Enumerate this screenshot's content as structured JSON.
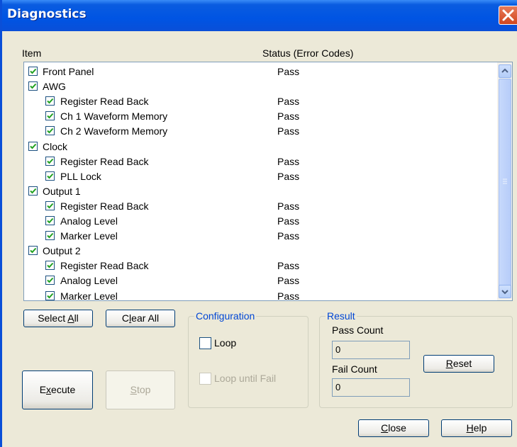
{
  "window": {
    "title": "Diagnostics"
  },
  "headers": {
    "item": "Item",
    "status": "Status (Error Codes)"
  },
  "items": [
    {
      "label": "Front Panel",
      "status": "Pass",
      "level": 0,
      "checked": true
    },
    {
      "label": "AWG",
      "status": "",
      "level": 0,
      "checked": true
    },
    {
      "label": "Register Read Back",
      "status": "Pass",
      "level": 1,
      "checked": true
    },
    {
      "label": "Ch 1 Waveform Memory",
      "status": "Pass",
      "level": 1,
      "checked": true
    },
    {
      "label": "Ch 2 Waveform Memory",
      "status": "Pass",
      "level": 1,
      "checked": true
    },
    {
      "label": "Clock",
      "status": "",
      "level": 0,
      "checked": true
    },
    {
      "label": "Register Read Back",
      "status": "Pass",
      "level": 1,
      "checked": true
    },
    {
      "label": "PLL Lock",
      "status": "Pass",
      "level": 1,
      "checked": true
    },
    {
      "label": "Output 1",
      "status": "",
      "level": 0,
      "checked": true
    },
    {
      "label": "Register Read Back",
      "status": "Pass",
      "level": 1,
      "checked": true
    },
    {
      "label": "Analog Level",
      "status": "Pass",
      "level": 1,
      "checked": true
    },
    {
      "label": "Marker Level",
      "status": "Pass",
      "level": 1,
      "checked": true
    },
    {
      "label": "Output 2",
      "status": "",
      "level": 0,
      "checked": true
    },
    {
      "label": "Register Read Back",
      "status": "Pass",
      "level": 1,
      "checked": true
    },
    {
      "label": "Analog Level",
      "status": "Pass",
      "level": 1,
      "checked": true
    },
    {
      "label": "Marker Level",
      "status": "Pass",
      "level": 1,
      "checked": true
    }
  ],
  "buttons": {
    "select_all": {
      "pre": "Select ",
      "key": "A",
      "post": "ll"
    },
    "clear_all": {
      "pre": "C",
      "key": "l",
      "post": "ear All"
    },
    "execute": {
      "pre": "E",
      "key": "x",
      "post": "ecute"
    },
    "stop": {
      "pre": "",
      "key": "S",
      "post": "top"
    },
    "reset": {
      "pre": "",
      "key": "R",
      "post": "eset"
    },
    "close": {
      "pre": "",
      "key": "C",
      "post": "lose"
    },
    "help": {
      "pre": "",
      "key": "H",
      "post": "elp"
    }
  },
  "configuration": {
    "title": "Configuration",
    "loop_label": "Loop",
    "loop_checked": false,
    "loop_until_fail_label": "Loop until Fail",
    "loop_until_fail_checked": false
  },
  "result": {
    "title": "Result",
    "pass_count_label": "Pass Count",
    "pass_count": "0",
    "fail_count_label": "Fail Count",
    "fail_count": "0"
  },
  "colors": {
    "title_bar": "#0054e3",
    "group_title": "#0046d5",
    "check_mark": "#21a121",
    "close_button": "#d0461f"
  }
}
